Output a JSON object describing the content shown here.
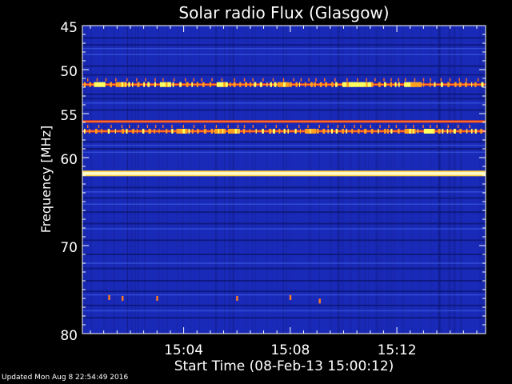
{
  "chart_data": {
    "type": "heatmap",
    "title": "Solar radio Flux (Glasgow)",
    "xlabel": "Start Time (08-Feb-13 15:00:12)",
    "ylabel": "Frequency [MHz]",
    "x_unit": "minutes after 15:00",
    "xlim": [
      0.2,
      15.33
    ],
    "ylim": [
      80,
      45
    ],
    "x_ticks": [
      {
        "value": 4,
        "label": "15:04"
      },
      {
        "value": 8,
        "label": "15:08"
      },
      {
        "value": 12,
        "label": "15:12"
      }
    ],
    "y_ticks": [
      {
        "value": 45,
        "label": "45"
      },
      {
        "value": 50,
        "label": "50"
      },
      {
        "value": 55,
        "label": "55"
      },
      {
        "value": 60,
        "label": "60"
      },
      {
        "value": 70,
        "label": "70"
      },
      {
        "value": 80,
        "label": "80"
      }
    ],
    "background_color": "#1a2ab8",
    "line_colors": {
      "dark": "#0d1878",
      "light": "#3a58e0"
    },
    "bright_bands": [
      {
        "freq": 51.7,
        "color": "#ff3a10",
        "intensity": "high",
        "bursty": true
      },
      {
        "freq": 55.9,
        "color": "#ff3a10",
        "intensity": "high",
        "bursty": false
      },
      {
        "freq": 57.0,
        "color": "#ff3a10",
        "intensity": "high",
        "bursty": true
      },
      {
        "freq": 61.8,
        "color": "#ffee88",
        "intensity": "very high",
        "bursty": false
      }
    ],
    "dark_lines": [
      46.4,
      47.2,
      49.6,
      50.6,
      52.8,
      53.3,
      54.6,
      58.2,
      59.0,
      63.4,
      64.6,
      66.2,
      67.5,
      69.4,
      71.0,
      72.6,
      74.0,
      75.2,
      76.8,
      78.2
    ],
    "light_lines": [
      47.6,
      48.3,
      53.8,
      58.6,
      59.4,
      63.9,
      65.3,
      68.1,
      72.0,
      75.6,
      77.4
    ],
    "sporadic_spots": [
      {
        "t": 1.2,
        "f": 75.9
      },
      {
        "t": 1.7,
        "f": 76.0
      },
      {
        "t": 3.0,
        "f": 76.0
      },
      {
        "t": 6.0,
        "f": 76.0
      },
      {
        "t": 8.0,
        "f": 75.9
      },
      {
        "t": 9.1,
        "f": 76.3
      }
    ]
  },
  "footer": {
    "updated_text": "Updated Mon Aug  8 22:54:49 2016"
  }
}
